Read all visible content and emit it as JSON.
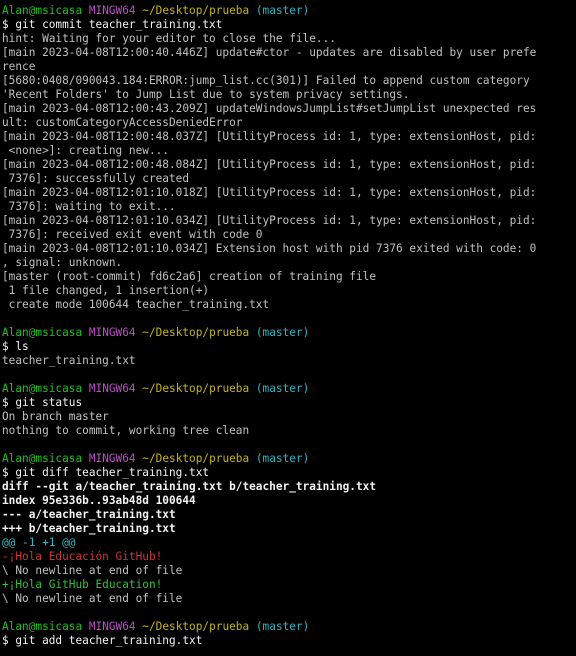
{
  "colors": {
    "background": "#000000",
    "text": "#c0c0c0",
    "prompt_user": "#1ec31e",
    "prompt_host": "#b84ec4",
    "prompt_path": "#c4b31e",
    "prompt_branch": "#2fb4c4",
    "diff_header": "#f2f2f2",
    "diff_hunk": "#2fb4c4",
    "diff_removed": "#d03434",
    "diff_added": "#2fc12f"
  },
  "lines": [
    {
      "segments": [
        {
          "text": "Alan@msicasa",
          "style": "green"
        },
        {
          "text": " ",
          "style": "gray"
        },
        {
          "text": "MINGW64",
          "style": "magenta"
        },
        {
          "text": " ",
          "style": "gray"
        },
        {
          "text": "~/Desktop/prueba",
          "style": "yellow"
        },
        {
          "text": " ",
          "style": "gray"
        },
        {
          "text": "(master)",
          "style": "cyan"
        }
      ]
    },
    {
      "segments": [
        {
          "text": "$ git commit teacher_training.txt",
          "style": "white"
        }
      ]
    },
    {
      "segments": [
        {
          "text": "hint: Waiting for your editor to close the file...",
          "style": "gray"
        }
      ]
    },
    {
      "segments": [
        {
          "text": "[main 2023-04-08T12:00:40.446Z] update#ctor - updates are disabled by user prefe",
          "style": "gray"
        }
      ]
    },
    {
      "segments": [
        {
          "text": "rence",
          "style": "gray"
        }
      ]
    },
    {
      "segments": [
        {
          "text": "[5680:0408/090043.184:ERROR:jump_list.cc(301)] Failed to append custom category",
          "style": "gray"
        }
      ]
    },
    {
      "segments": [
        {
          "text": "'Recent Folders' to Jump List due to system privacy settings.",
          "style": "gray"
        }
      ]
    },
    {
      "segments": [
        {
          "text": "[main 2023-04-08T12:00:43.209Z] updateWindowsJumpList#setJumpList unexpected res",
          "style": "gray"
        }
      ]
    },
    {
      "segments": [
        {
          "text": "ult: customCategoryAccessDeniedError",
          "style": "gray"
        }
      ]
    },
    {
      "segments": [
        {
          "text": "[main 2023-04-08T12:00:48.037Z] [UtilityProcess id: 1, type: extensionHost, pid:",
          "style": "gray"
        }
      ]
    },
    {
      "segments": [
        {
          "text": " <none>]: creating new...",
          "style": "gray"
        }
      ]
    },
    {
      "segments": [
        {
          "text": "[main 2023-04-08T12:00:48.084Z] [UtilityProcess id: 1, type: extensionHost, pid:",
          "style": "gray"
        }
      ]
    },
    {
      "segments": [
        {
          "text": " 7376]: successfully created",
          "style": "gray"
        }
      ]
    },
    {
      "segments": [
        {
          "text": "[main 2023-04-08T12:01:10.018Z] [UtilityProcess id: 1, type: extensionHost, pid:",
          "style": "gray"
        }
      ]
    },
    {
      "segments": [
        {
          "text": " 7376]: waiting to exit...",
          "style": "gray"
        }
      ]
    },
    {
      "segments": [
        {
          "text": "[main 2023-04-08T12:01:10.034Z] [UtilityProcess id: 1, type: extensionHost, pid:",
          "style": "gray"
        }
      ]
    },
    {
      "segments": [
        {
          "text": " 7376]: received exit event with code 0",
          "style": "gray"
        }
      ]
    },
    {
      "segments": [
        {
          "text": "[main 2023-04-08T12:01:10.034Z] Extension host with pid 7376 exited with code: 0",
          "style": "gray"
        }
      ]
    },
    {
      "segments": [
        {
          "text": ", signal: unknown.",
          "style": "gray"
        }
      ]
    },
    {
      "segments": [
        {
          "text": "[master (root-commit) fd6c2a6] creation of training file",
          "style": "gray"
        }
      ]
    },
    {
      "segments": [
        {
          "text": " 1 file changed, 1 insertion(+)",
          "style": "gray"
        }
      ]
    },
    {
      "segments": [
        {
          "text": " create mode 100644 teacher_training.txt",
          "style": "gray"
        }
      ]
    },
    {
      "segments": [
        {
          "text": "",
          "style": "gray"
        }
      ]
    },
    {
      "segments": [
        {
          "text": "Alan@msicasa",
          "style": "green"
        },
        {
          "text": " ",
          "style": "gray"
        },
        {
          "text": "MINGW64",
          "style": "magenta"
        },
        {
          "text": " ",
          "style": "gray"
        },
        {
          "text": "~/Desktop/prueba",
          "style": "yellow"
        },
        {
          "text": " ",
          "style": "gray"
        },
        {
          "text": "(master)",
          "style": "cyan"
        }
      ]
    },
    {
      "segments": [
        {
          "text": "$ ls",
          "style": "white"
        }
      ]
    },
    {
      "segments": [
        {
          "text": "teacher_training.txt",
          "style": "gray"
        }
      ]
    },
    {
      "segments": [
        {
          "text": "",
          "style": "gray"
        }
      ]
    },
    {
      "segments": [
        {
          "text": "Alan@msicasa",
          "style": "green"
        },
        {
          "text": " ",
          "style": "gray"
        },
        {
          "text": "MINGW64",
          "style": "magenta"
        },
        {
          "text": " ",
          "style": "gray"
        },
        {
          "text": "~/Desktop/prueba",
          "style": "yellow"
        },
        {
          "text": " ",
          "style": "gray"
        },
        {
          "text": "(master)",
          "style": "cyan"
        }
      ]
    },
    {
      "segments": [
        {
          "text": "$ git status",
          "style": "white"
        }
      ]
    },
    {
      "segments": [
        {
          "text": "On branch master",
          "style": "gray"
        }
      ]
    },
    {
      "segments": [
        {
          "text": "nothing to commit, working tree clean",
          "style": "gray"
        }
      ]
    },
    {
      "segments": [
        {
          "text": "",
          "style": "gray"
        }
      ]
    },
    {
      "segments": [
        {
          "text": "Alan@msicasa",
          "style": "green"
        },
        {
          "text": " ",
          "style": "gray"
        },
        {
          "text": "MINGW64",
          "style": "magenta"
        },
        {
          "text": " ",
          "style": "gray"
        },
        {
          "text": "~/Desktop/prueba",
          "style": "yellow"
        },
        {
          "text": " ",
          "style": "gray"
        },
        {
          "text": "(master)",
          "style": "cyan"
        }
      ]
    },
    {
      "segments": [
        {
          "text": "$ git diff teacher_training.txt",
          "style": "white"
        }
      ]
    },
    {
      "segments": [
        {
          "text": "diff --git a/teacher_training.txt b/teacher_training.txt",
          "style": "bold"
        }
      ]
    },
    {
      "segments": [
        {
          "text": "index 95e336b..93ab48d 100644",
          "style": "bold"
        }
      ]
    },
    {
      "segments": [
        {
          "text": "--- a/teacher_training.txt",
          "style": "bold"
        }
      ]
    },
    {
      "segments": [
        {
          "text": "+++ b/teacher_training.txt",
          "style": "bold"
        }
      ]
    },
    {
      "segments": [
        {
          "text": "@@ -1 +1 @@",
          "style": "cyan"
        }
      ]
    },
    {
      "segments": [
        {
          "text": "-¡Hola Educación GitHub!",
          "style": "red"
        }
      ]
    },
    {
      "segments": [
        {
          "text": "\\ No newline at end of file",
          "style": "gray"
        }
      ]
    },
    {
      "segments": [
        {
          "text": "+¡Hola GitHub Education!",
          "style": "addgreen"
        }
      ]
    },
    {
      "segments": [
        {
          "text": "\\ No newline at end of file",
          "style": "gray"
        }
      ]
    },
    {
      "segments": [
        {
          "text": "",
          "style": "gray"
        }
      ]
    },
    {
      "segments": [
        {
          "text": "Alan@msicasa",
          "style": "green"
        },
        {
          "text": " ",
          "style": "gray"
        },
        {
          "text": "MINGW64",
          "style": "magenta"
        },
        {
          "text": " ",
          "style": "gray"
        },
        {
          "text": "~/Desktop/prueba",
          "style": "yellow"
        },
        {
          "text": " ",
          "style": "gray"
        },
        {
          "text": "(master)",
          "style": "cyan"
        }
      ]
    },
    {
      "segments": [
        {
          "text": "$ git add teacher_training.txt",
          "style": "white"
        }
      ]
    }
  ]
}
